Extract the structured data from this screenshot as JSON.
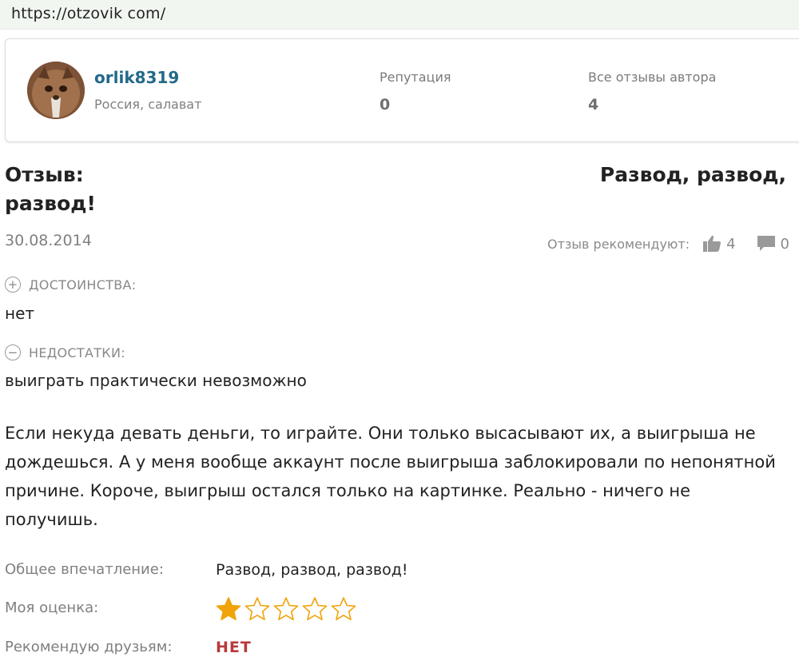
{
  "browser": {
    "url": "https://otzovik com/"
  },
  "author": {
    "name": "orlik8319",
    "location": "Россия, салават",
    "reputation_label": "Репутация",
    "reputation_value": "0",
    "reviews_label": "Все отзывы автора",
    "reviews_value": "4"
  },
  "review": {
    "title_label": "Отзыв:",
    "title_line1": "Развод, развод,",
    "title_line2": "развод!",
    "date": "30.08.2014",
    "recommend_label": "Отзыв рекомендуют:",
    "likes": "4",
    "comments": "0",
    "pros_label": "ДОСТОИНСТВА:",
    "pros_text": "нет",
    "cons_label": "НЕДОСТАТКИ:",
    "cons_text": "выиграть практически невозможно",
    "body_lines": [
      "Если некуда девать деньги, то играйте. Они только высасывают их, а выигрыша не",
      "дождешься. А у меня вообще аккаунт после выигрыша заблокировали по непонятной",
      "причине. Короче, выигрыш остался только на картинке. Реально - ничего не",
      "получишь."
    ],
    "impression_label": "Общее впечатление:",
    "impression_value": "Развод, развод, развод!",
    "rating_label": "Моя оценка:",
    "rating": 1,
    "rating_max": 5,
    "recommend_friends_label": "Рекомендую друзьям:",
    "recommend_friends_value": "НЕТ"
  },
  "colors": {
    "author_link": "#236989",
    "star_filled": "#f0a30a",
    "star_empty_stroke": "#f0a30a",
    "negative": "#b73a3a"
  }
}
